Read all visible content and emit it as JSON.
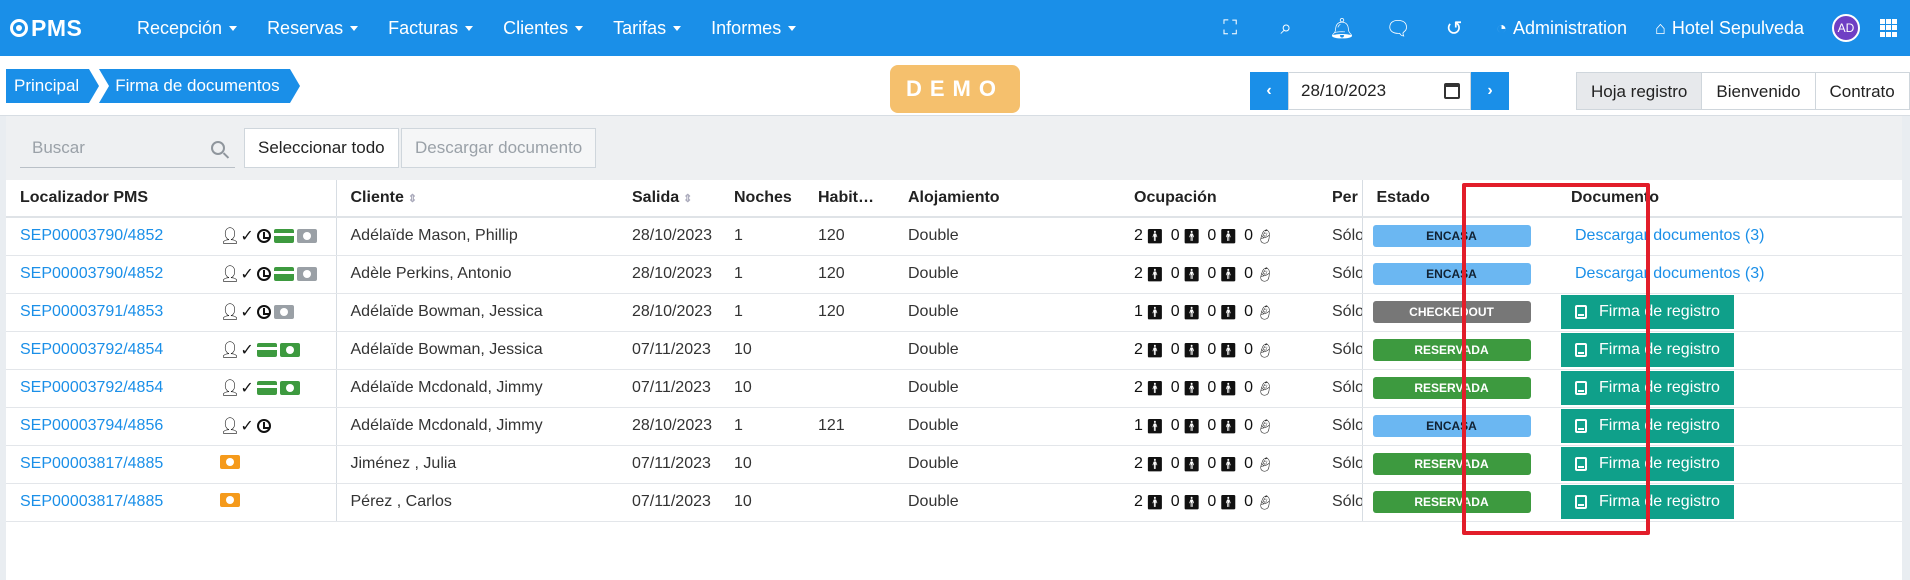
{
  "app": {
    "logo_text": "PMS"
  },
  "nav": {
    "menus": [
      {
        "label": "Recepción"
      },
      {
        "label": "Reservas"
      },
      {
        "label": "Facturas"
      },
      {
        "label": "Clientes"
      },
      {
        "label": "Tarifas"
      },
      {
        "label": "Informes"
      }
    ],
    "admin_label": "Administration",
    "hotel_label": "Hotel Sepulveda",
    "avatar_initials": "AD",
    "icons": [
      "fullscreen-icon",
      "search-icon",
      "bell-icon",
      "chat-icon",
      "history-icon",
      "dashboard-icon",
      "home-icon",
      "apps-grid-icon"
    ]
  },
  "breadcrumb": [
    {
      "label": "Principal"
    },
    {
      "label": "Firma de documentos"
    }
  ],
  "demo_label": "DEMO",
  "date_picker": {
    "value": "28/10/2023",
    "prev": "‹",
    "next": "›"
  },
  "view_tabs": [
    {
      "label": "Hoja registro",
      "active": true
    },
    {
      "label": "Bienvenido"
    },
    {
      "label": "Contrato"
    }
  ],
  "toolbar": {
    "search_placeholder": "Buscar",
    "select_all": "Seleccionar todo",
    "download_doc": "Descargar documento"
  },
  "table": {
    "headers": {
      "localizador": "Localizador PMS",
      "cliente": "Cliente",
      "salida": "Salida",
      "noches": "Noches",
      "habitacion": "Habit…",
      "alojamiento": "Alojamiento",
      "ocupacion": "Ocupación",
      "per": "Per",
      "estado": "Estado",
      "documento": "Documento"
    },
    "rows": [
      {
        "loc": "SEP00003790/4852",
        "cliente": "Adélaïde Mason, Phillip",
        "salida": "28/10/2023",
        "noches": "1",
        "hab": "120",
        "aloj": "Double",
        "occ": [
          "2",
          "0",
          "0",
          "0"
        ],
        "per": "Sólo",
        "estado": "ENCASA",
        "doc_type": "link",
        "doc": "Descargar documentos (3)"
      },
      {
        "loc": "SEP00003790/4852",
        "cliente": "Adèle Perkins, Antonio",
        "salida": "28/10/2023",
        "noches": "1",
        "hab": "120",
        "aloj": "Double",
        "occ": [
          "2",
          "0",
          "0",
          "0"
        ],
        "per": "Sólo",
        "estado": "ENCASA",
        "doc_type": "link",
        "doc": "Descargar documentos (3)"
      },
      {
        "loc": "SEP00003791/4853",
        "cliente": "Adélaïde Bowman, Jessica",
        "salida": "28/10/2023",
        "noches": "1",
        "hab": "120",
        "aloj": "Double",
        "occ": [
          "1",
          "0",
          "0",
          "0"
        ],
        "per": "Sólo",
        "estado": "CHECKEDOUT",
        "doc_type": "button",
        "doc": "Firma de registro"
      },
      {
        "loc": "SEP00003792/4854",
        "cliente": "Adélaïde Bowman, Jessica",
        "salida": "07/11/2023",
        "noches": "10",
        "hab": "",
        "aloj": "Double",
        "occ": [
          "2",
          "0",
          "0",
          "0"
        ],
        "per": "Sólo",
        "estado": "RESERVADA",
        "doc_type": "button",
        "doc": "Firma de registro"
      },
      {
        "loc": "SEP00003792/4854",
        "cliente": "Adélaïde Mcdonald, Jimmy",
        "salida": "07/11/2023",
        "noches": "10",
        "hab": "",
        "aloj": "Double",
        "occ": [
          "2",
          "0",
          "0",
          "0"
        ],
        "per": "Sólo",
        "estado": "RESERVADA",
        "doc_type": "button",
        "doc": "Firma de registro"
      },
      {
        "loc": "SEP00003794/4856",
        "cliente": "Adélaïde Mcdonald, Jimmy",
        "salida": "28/10/2023",
        "noches": "1",
        "hab": "121",
        "aloj": "Double",
        "occ": [
          "1",
          "0",
          "0",
          "0"
        ],
        "per": "Sólo",
        "estado": "ENCASA",
        "doc_type": "button",
        "doc": "Firma de registro"
      },
      {
        "loc": "SEP00003817/4885",
        "cliente": "Jiménez , Julia",
        "salida": "07/11/2023",
        "noches": "10",
        "hab": "",
        "aloj": "Double",
        "occ": [
          "2",
          "0",
          "0",
          "0"
        ],
        "per": "Sólo",
        "estado": "RESERVADA",
        "doc_type": "button",
        "doc": "Firma de registro"
      },
      {
        "loc": "SEP00003817/4885",
        "cliente": "Pérez , Carlos",
        "salida": "07/11/2023",
        "noches": "10",
        "hab": "",
        "aloj": "Double",
        "occ": [
          "2",
          "0",
          "0",
          "0"
        ],
        "per": "Sólo",
        "estado": "RESERVADA",
        "doc_type": "button",
        "doc": "Firma de registro"
      }
    ],
    "row_icons": [
      [
        "user-check-icon",
        "clock-icon",
        "card-green-icon",
        "cash-gray-icon"
      ],
      [
        "user-check-icon",
        "clock-icon",
        "card-green-icon",
        "cash-gray-icon"
      ],
      [
        "user-check-icon",
        "clock-icon",
        "cash-gray-icon"
      ],
      [
        "user-check-icon",
        "card-green-icon",
        "cash-green-icon"
      ],
      [
        "user-check-icon",
        "card-green-icon",
        "cash-green-icon"
      ],
      [
        "user-check-icon",
        "clock-icon"
      ],
      [
        "cash-orange-icon"
      ],
      [
        "cash-orange-icon"
      ]
    ]
  },
  "colors": {
    "primary": "#1a8fe8",
    "encasa": "#6bb7f2",
    "checkedout": "#777777",
    "reservada": "#3d9a3f",
    "doc_button": "#0fa08a",
    "demo": "#f5c06d",
    "highlight": "#e21d2a",
    "icon_green": "#3d9a3f",
    "icon_gray": "#9aa0a6",
    "icon_orange": "#f59a1b"
  }
}
